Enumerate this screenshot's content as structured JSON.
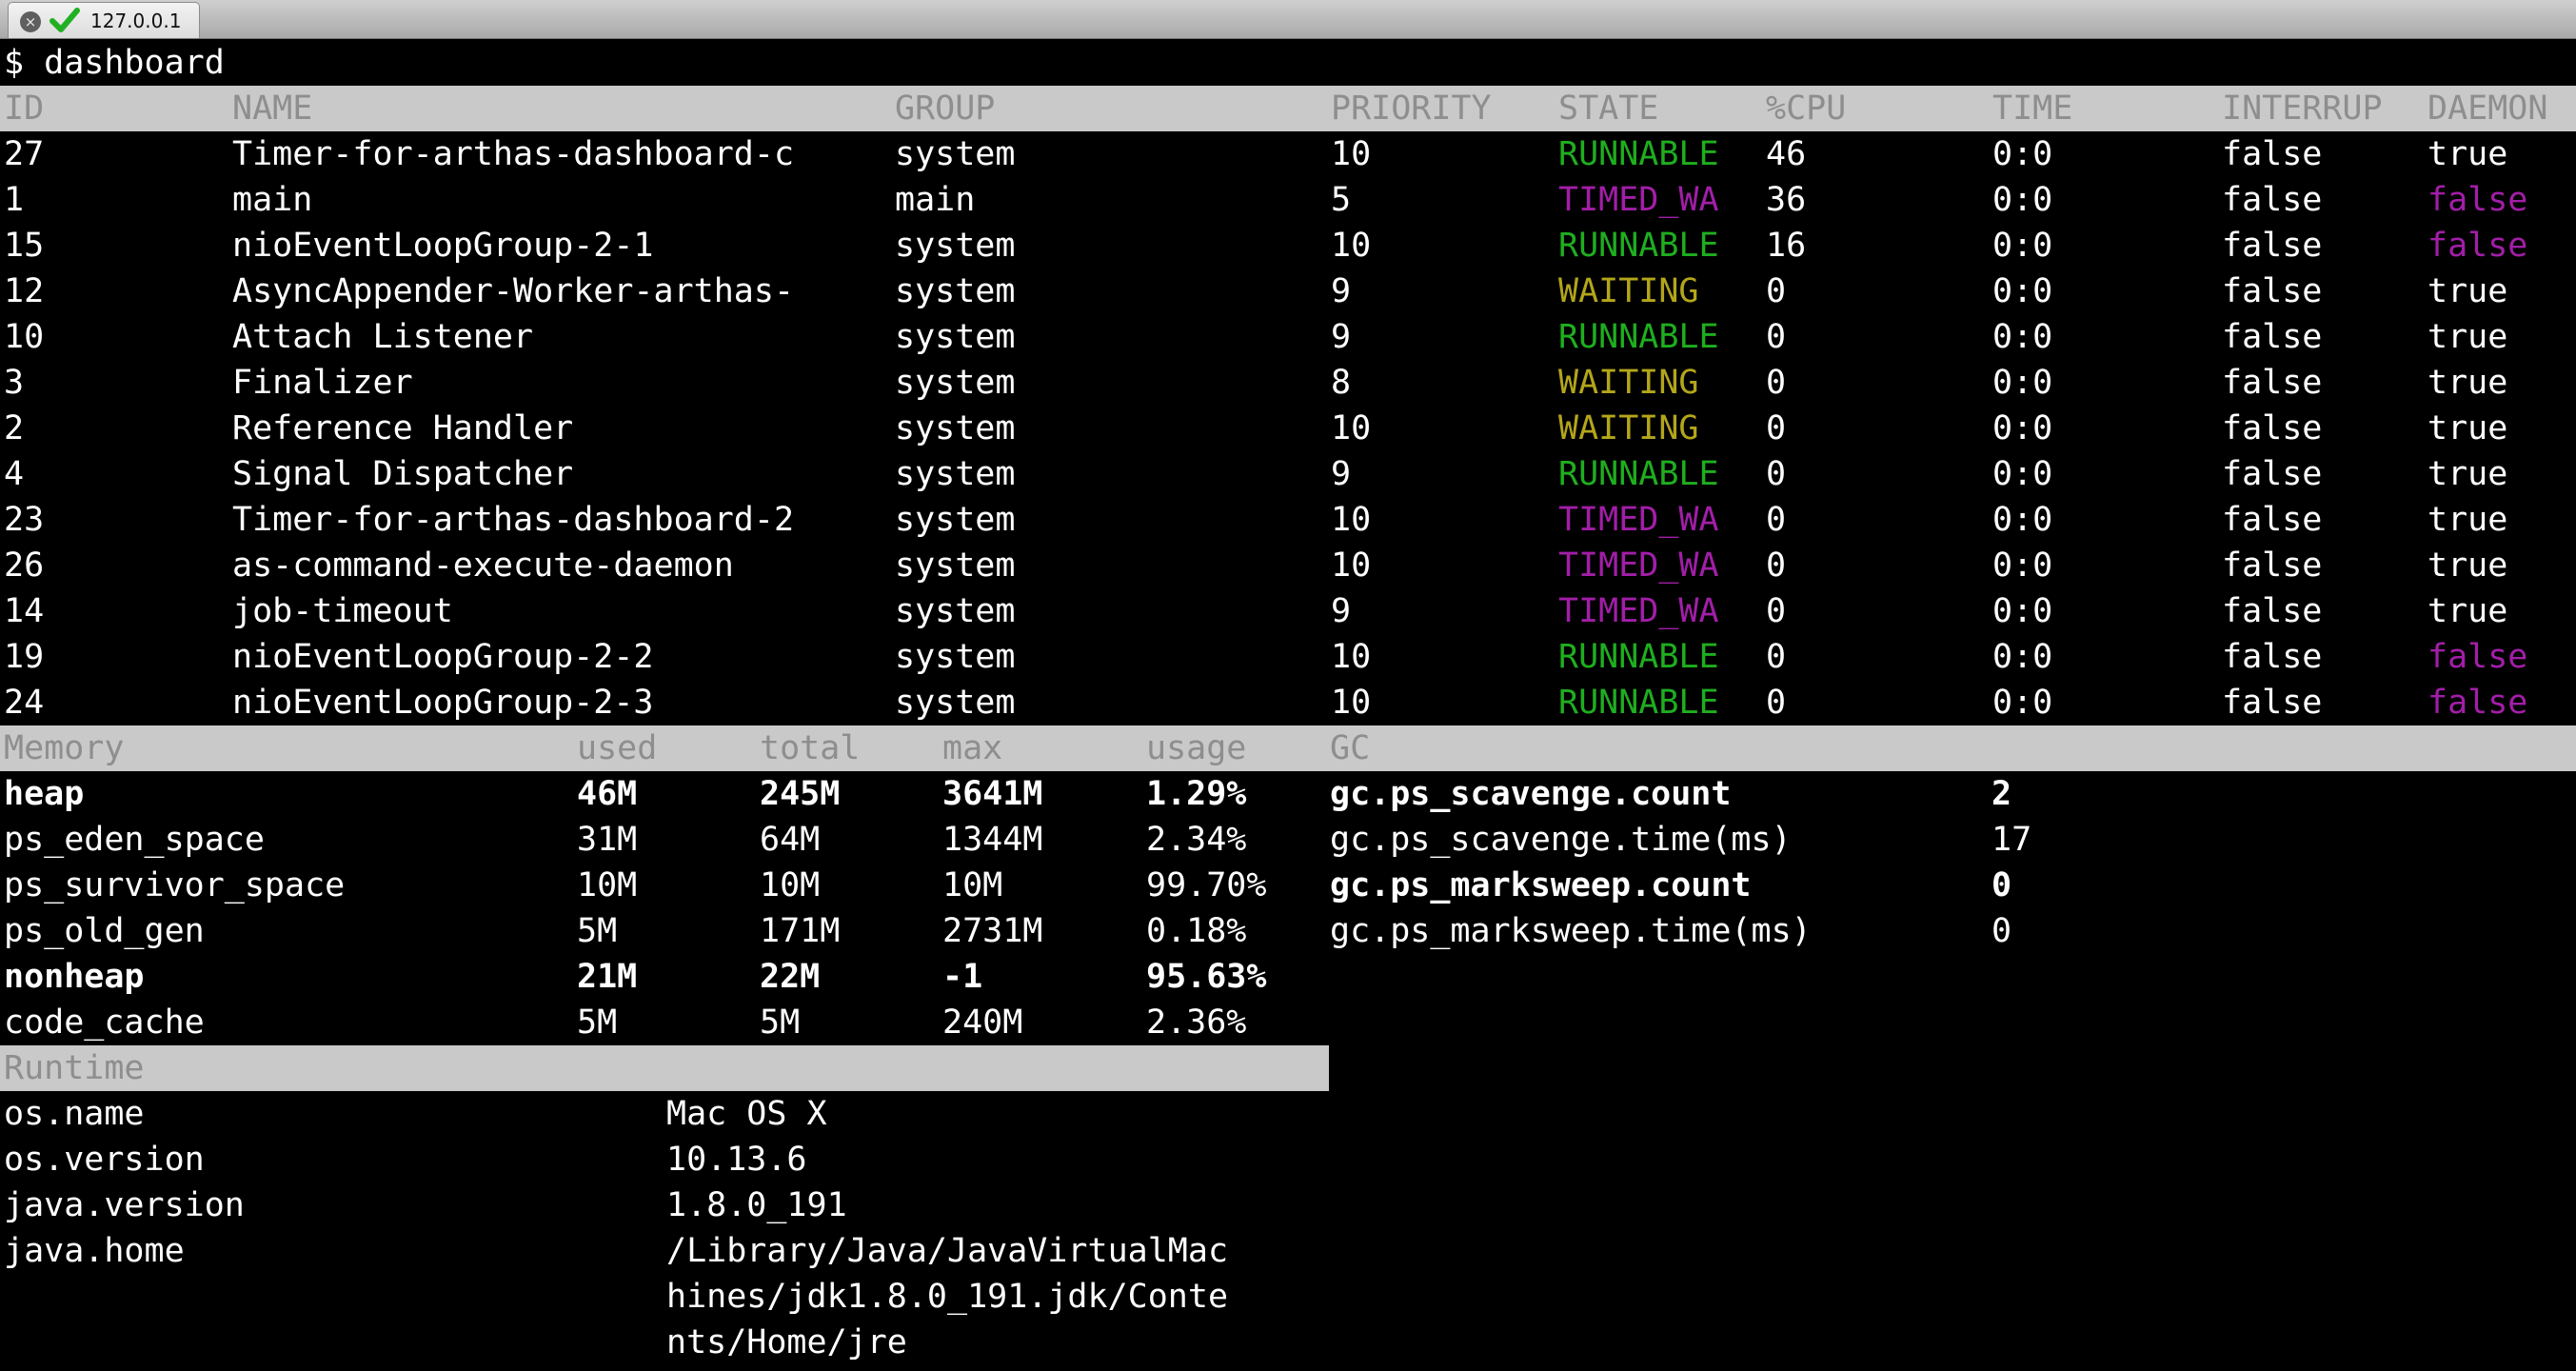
{
  "window": {
    "tab_title": "127.0.0.1",
    "close_glyph": "×"
  },
  "colors": {
    "runnable": "#1fae1f",
    "waiting": "#b3a61a",
    "timed_waiting": "#a21ea8",
    "header_bg": "#c9c9c9",
    "header_text": "#8e8e8e"
  },
  "prompt": "$ dashboard",
  "threads": {
    "headers": {
      "id": "ID",
      "name": "NAME",
      "group": "GROUP",
      "priority": "PRIORITY",
      "state": "STATE",
      "cpu": "%CPU",
      "time": "TIME",
      "interrupted": "INTERRUP",
      "daemon": "DAEMON"
    },
    "rows": [
      {
        "id": "27",
        "name": "Timer-for-arthas-dashboard-c",
        "group": "system",
        "priority": "10",
        "state": "RUNNABLE",
        "cpu": "46",
        "time": "0:0",
        "interrupted": "false",
        "daemon": "true"
      },
      {
        "id": "1",
        "name": "main",
        "group": "main",
        "priority": "5",
        "state": "TIMED_WA",
        "cpu": "36",
        "time": "0:0",
        "interrupted": "false",
        "daemon": "false"
      },
      {
        "id": "15",
        "name": "nioEventLoopGroup-2-1",
        "group": "system",
        "priority": "10",
        "state": "RUNNABLE",
        "cpu": "16",
        "time": "0:0",
        "interrupted": "false",
        "daemon": "false"
      },
      {
        "id": "12",
        "name": "AsyncAppender-Worker-arthas-",
        "group": "system",
        "priority": "9",
        "state": "WAITING",
        "cpu": "0",
        "time": "0:0",
        "interrupted": "false",
        "daemon": "true"
      },
      {
        "id": "10",
        "name": "Attach Listener",
        "group": "system",
        "priority": "9",
        "state": "RUNNABLE",
        "cpu": "0",
        "time": "0:0",
        "interrupted": "false",
        "daemon": "true"
      },
      {
        "id": "3",
        "name": "Finalizer",
        "group": "system",
        "priority": "8",
        "state": "WAITING",
        "cpu": "0",
        "time": "0:0",
        "interrupted": "false",
        "daemon": "true"
      },
      {
        "id": "2",
        "name": "Reference Handler",
        "group": "system",
        "priority": "10",
        "state": "WAITING",
        "cpu": "0",
        "time": "0:0",
        "interrupted": "false",
        "daemon": "true"
      },
      {
        "id": "4",
        "name": "Signal Dispatcher",
        "group": "system",
        "priority": "9",
        "state": "RUNNABLE",
        "cpu": "0",
        "time": "0:0",
        "interrupted": "false",
        "daemon": "true"
      },
      {
        "id": "23",
        "name": "Timer-for-arthas-dashboard-2",
        "group": "system",
        "priority": "10",
        "state": "TIMED_WA",
        "cpu": "0",
        "time": "0:0",
        "interrupted": "false",
        "daemon": "true"
      },
      {
        "id": "26",
        "name": "as-command-execute-daemon",
        "group": "system",
        "priority": "10",
        "state": "TIMED_WA",
        "cpu": "0",
        "time": "0:0",
        "interrupted": "false",
        "daemon": "true"
      },
      {
        "id": "14",
        "name": "job-timeout",
        "group": "system",
        "priority": "9",
        "state": "TIMED_WA",
        "cpu": "0",
        "time": "0:0",
        "interrupted": "false",
        "daemon": "true"
      },
      {
        "id": "19",
        "name": "nioEventLoopGroup-2-2",
        "group": "system",
        "priority": "10",
        "state": "RUNNABLE",
        "cpu": "0",
        "time": "0:0",
        "interrupted": "false",
        "daemon": "false"
      },
      {
        "id": "24",
        "name": "nioEventLoopGroup-2-3",
        "group": "system",
        "priority": "10",
        "state": "RUNNABLE",
        "cpu": "0",
        "time": "0:0",
        "interrupted": "false",
        "daemon": "false"
      }
    ]
  },
  "memory": {
    "headers": {
      "name": "Memory",
      "used": "used",
      "total": "total",
      "max": "max",
      "usage": "usage"
    },
    "rows": [
      {
        "name": "heap",
        "used": "46M",
        "total": "245M",
        "max": "3641M",
        "usage": "1.29%",
        "bold": true
      },
      {
        "name": "ps_eden_space",
        "used": "31M",
        "total": "64M",
        "max": "1344M",
        "usage": "2.34%",
        "bold": false
      },
      {
        "name": "ps_survivor_space",
        "used": "10M",
        "total": "10M",
        "max": "10M",
        "usage": "99.70%",
        "bold": false
      },
      {
        "name": "ps_old_gen",
        "used": "5M",
        "total": "171M",
        "max": "2731M",
        "usage": "0.18%",
        "bold": false
      },
      {
        "name": "nonheap",
        "used": "21M",
        "total": "22M",
        "max": "-1",
        "usage": "95.63%",
        "bold": true
      },
      {
        "name": "code_cache",
        "used": "5M",
        "total": "5M",
        "max": "240M",
        "usage": "2.36%",
        "bold": false
      }
    ]
  },
  "gc": {
    "header": "GC",
    "rows": [
      {
        "name": "gc.ps_scavenge.count",
        "value": "2",
        "bold": true
      },
      {
        "name": "gc.ps_scavenge.time(ms)",
        "value": "17",
        "bold": false
      },
      {
        "name": "gc.ps_marksweep.count",
        "value": "0",
        "bold": true
      },
      {
        "name": "gc.ps_marksweep.time(ms)",
        "value": "0",
        "bold": false
      }
    ]
  },
  "runtime": {
    "header": "Runtime",
    "rows": [
      {
        "name": "os.name",
        "value": "Mac OS X"
      },
      {
        "name": "os.version",
        "value": "10.13.6"
      },
      {
        "name": "java.version",
        "value": "1.8.0_191"
      },
      {
        "name": "java.home",
        "value": "/Library/Java/JavaVirtualMac"
      },
      {
        "name": "",
        "value": "hines/jdk1.8.0_191.jdk/Conte"
      },
      {
        "name": "",
        "value": "nts/Home/jre"
      }
    ]
  }
}
